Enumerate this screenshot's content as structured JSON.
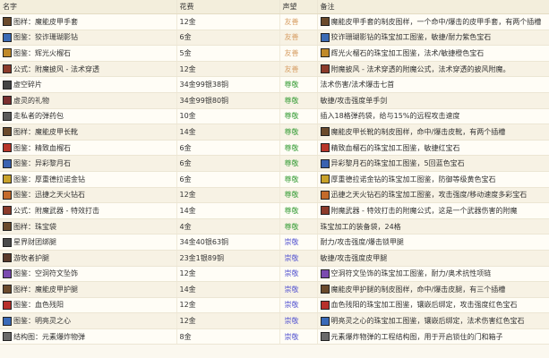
{
  "headers": {
    "name": "名字",
    "cost": "花费",
    "rep": "声望",
    "note": "备注"
  },
  "rows": [
    {
      "icon": "gloves-icon",
      "iconColor": "#6b4a2b",
      "name": "图样：魔能皮甲手套",
      "cost": "12金",
      "rep": "友善",
      "repClass": "neutral",
      "noteIcon": "gloves-icon",
      "noteIconColor": "#6b4a2b",
      "note": "魔能皮甲手套的制皮图样，一个命中/爆击的皮甲手套，有两个插槽"
    },
    {
      "icon": "gem-icon",
      "iconColor": "#3b6bb5",
      "name": "图鉴：狡诈珊瑚影钻",
      "cost": "6金",
      "rep": "友善",
      "repClass": "neutral",
      "noteIcon": "gem-icon",
      "noteIconColor": "#3b6bb5",
      "note": "狡诈珊瑚影钻的珠宝加工图鉴，敏捷/耐力紫色宝石"
    },
    {
      "icon": "gem-icon",
      "iconColor": "#c08a2a",
      "name": "图鉴：辉光火榴石",
      "cost": "5金",
      "rep": "友善",
      "repClass": "neutral",
      "noteIcon": "gem-icon",
      "noteIconColor": "#c08a2a",
      "note": "辉光火榴石的珠宝加工图鉴，法术/敏捷橙色宝石"
    },
    {
      "icon": "scroll-icon",
      "iconColor": "#8c3b2a",
      "name": "公式：附魔披风 - 法术穿透",
      "cost": "12金",
      "rep": "友善",
      "repClass": "neutral",
      "noteIcon": "scroll-icon",
      "noteIconColor": "#8c3b2a",
      "note": "附魔披风 - 法术穿透的附魔公式，法术穿透的披风附魔。"
    },
    {
      "icon": "crystal-icon",
      "iconColor": "#444444",
      "name": "虚空碎片",
      "cost": "34金99银38铜",
      "rep": "尊敬",
      "repClass": "honored",
      "noteIcon": "",
      "noteIconColor": "",
      "note": "法术伤害/法术爆击七首"
    },
    {
      "icon": "ring-icon",
      "iconColor": "#7a2f2f",
      "name": "虚灵的礼物",
      "cost": "34金99银80铜",
      "rep": "尊敬",
      "repClass": "honored",
      "noteIcon": "",
      "noteIconColor": "",
      "note": "敏捷/攻击强度单手剑"
    },
    {
      "icon": "ammo-icon",
      "iconColor": "#5a5a5a",
      "name": "走私者的弹药包",
      "cost": "10金",
      "rep": "尊敬",
      "repClass": "honored",
      "noteIcon": "",
      "noteIconColor": "",
      "note": "插入18格弹药袋，给与15%的远程攻击速度"
    },
    {
      "icon": "boots-icon",
      "iconColor": "#6b4a2b",
      "name": "图样：魔能皮甲长靴",
      "cost": "14金",
      "rep": "尊敬",
      "repClass": "honored",
      "noteIcon": "boots-icon",
      "noteIconColor": "#6b4a2b",
      "note": "魔能皮甲长靴的制皮图样，命中/爆击皮靴，有两个插槽"
    },
    {
      "icon": "gem-icon",
      "iconColor": "#b8362a",
      "name": "图鉴：精致血榴石",
      "cost": "6金",
      "rep": "尊敬",
      "repClass": "honored",
      "noteIcon": "gem-icon",
      "noteIconColor": "#b8362a",
      "note": "精致血榴石的珠宝加工图鉴，敏捷红宝石"
    },
    {
      "icon": "gem-icon",
      "iconColor": "#3a62b0",
      "name": "图鉴：异彩黎月石",
      "cost": "6金",
      "rep": "尊敬",
      "repClass": "honored",
      "noteIcon": "gem-icon",
      "noteIconColor": "#3a62b0",
      "note": "异彩黎月石的珠宝加工图鉴，5回蓝色宝石"
    },
    {
      "icon": "gem-icon",
      "iconColor": "#c9a22a",
      "name": "图鉴：厚重德拉诺金钻",
      "cost": "6金",
      "rep": "尊敬",
      "repClass": "honored",
      "noteIcon": "gem-icon",
      "noteIconColor": "#c9a22a",
      "note": "厚重德拉诺金钻的珠宝加工图鉴，防御等级黄色宝石"
    },
    {
      "icon": "gem-icon",
      "iconColor": "#c46a2a",
      "name": "图鉴：迅捷之天火钻石",
      "cost": "12金",
      "rep": "尊敬",
      "repClass": "honored",
      "noteIcon": "gem-icon",
      "noteIconColor": "#c46a2a",
      "note": "迅捷之天火钻石的珠宝加工图鉴，攻击强度/移动速度多彩宝石"
    },
    {
      "icon": "scroll-icon",
      "iconColor": "#8c3b2a",
      "name": "公式：附魔武器 - 特效打击",
      "cost": "14金",
      "rep": "尊敬",
      "repClass": "honored",
      "noteIcon": "scroll-icon",
      "noteIconColor": "#8c3b2a",
      "note": "附魔武器 - 特效打击的附魔公式，这是一个武器伤害的附魔"
    },
    {
      "icon": "bag-icon",
      "iconColor": "#6b4a2b",
      "name": "图样：珠宝袋",
      "cost": "4金",
      "rep": "尊敬",
      "repClass": "honored",
      "noteIcon": "",
      "noteIconColor": "",
      "note": "珠宝加工的装备袋，24格"
    },
    {
      "icon": "leg-icon",
      "iconColor": "#4a4a4a",
      "name": "星界财团绑腿",
      "cost": "34金40银63铜",
      "rep": "崇敬",
      "repClass": "revered",
      "noteIcon": "",
      "noteIconColor": "",
      "note": "耐力/攻击强度/爆击锁甲腿"
    },
    {
      "icon": "leg-icon",
      "iconColor": "#5a3a2a",
      "name": "游牧者护腿",
      "cost": "23金1银89铜",
      "rep": "崇敬",
      "repClass": "revered",
      "noteIcon": "",
      "noteIconColor": "",
      "note": "敏捷/攻击强度皮甲腿"
    },
    {
      "icon": "gem-icon",
      "iconColor": "#7a4ab0",
      "name": "图鉴：空洞符文坠饰",
      "cost": "12金",
      "rep": "崇敬",
      "repClass": "revered",
      "noteIcon": "gem-icon",
      "noteIconColor": "#7a4ab0",
      "note": "空洞符文坠饰的珠宝加工图鉴，耐力/奥术抗性项链"
    },
    {
      "icon": "leg-icon",
      "iconColor": "#6b4a2b",
      "name": "图样：魔能皮甲护腿",
      "cost": "14金",
      "rep": "崇敬",
      "repClass": "revered",
      "noteIcon": "leg-icon",
      "noteIconColor": "#6b4a2b",
      "note": "魔能皮甲护腿的制皮图样，命中/爆击皮腿，有三个插槽"
    },
    {
      "icon": "gem-icon",
      "iconColor": "#b8302a",
      "name": "图鉴：血色残阳",
      "cost": "12金",
      "rep": "崇敬",
      "repClass": "revered",
      "noteIcon": "gem-icon",
      "noteIconColor": "#b8302a",
      "note": "血色残阳的珠宝加工图鉴，镶嵌后绑定，攻击强度红色宝石"
    },
    {
      "icon": "gem-icon",
      "iconColor": "#3a6ab8",
      "name": "图鉴：明亮灵之心",
      "cost": "12金",
      "rep": "崇敬",
      "repClass": "revered",
      "noteIcon": "gem-icon",
      "noteIconColor": "#3a6ab8",
      "note": "明亮灵之心的珠宝加工图鉴，镶嵌后绑定，法术伤害红色宝石"
    },
    {
      "icon": "gear-icon",
      "iconColor": "#6a6a6a",
      "name": "结构图：元素爆炸物弹",
      "cost": "8金",
      "rep": "崇敬",
      "repClass": "revered",
      "noteIcon": "gear-icon",
      "noteIconColor": "#6a6a6a",
      "note": "元素爆炸物弹的工程结构图，用于开启锁住的门和箱子"
    }
  ]
}
